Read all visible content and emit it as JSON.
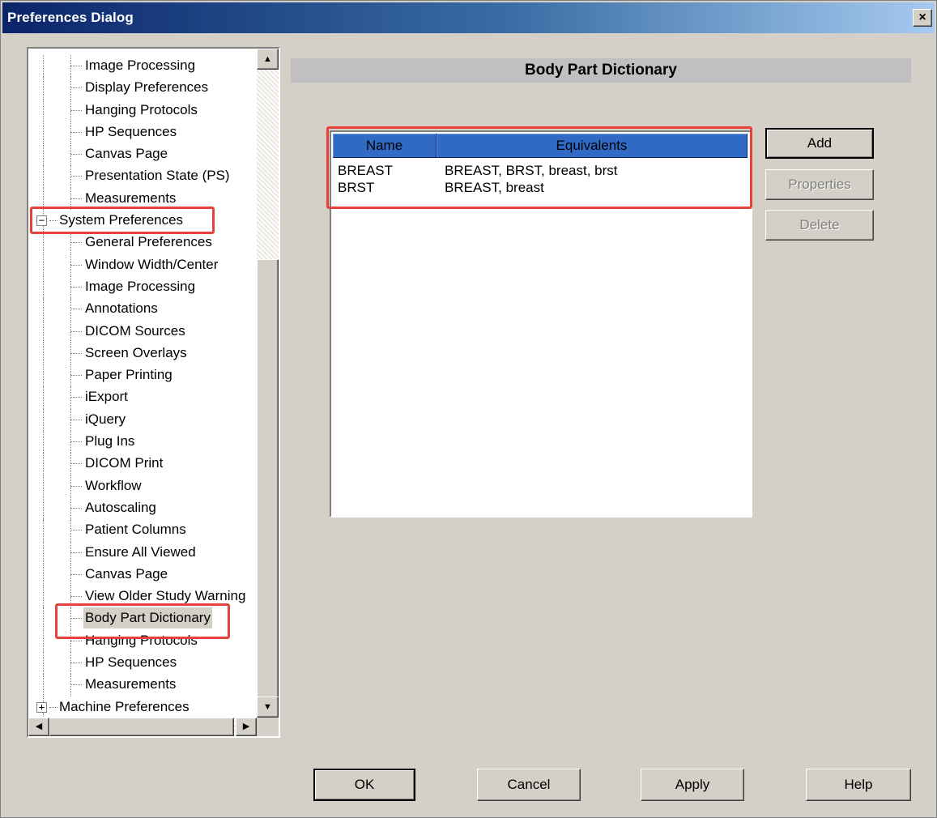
{
  "window": {
    "title": "Preferences Dialog",
    "close_label": "×"
  },
  "tree": {
    "items": [
      {
        "label": "Image Processing",
        "level": 1
      },
      {
        "label": "Display Preferences",
        "level": 1
      },
      {
        "label": "Hanging Protocols",
        "level": 1
      },
      {
        "label": "HP Sequences",
        "level": 1
      },
      {
        "label": "Canvas Page",
        "level": 1
      },
      {
        "label": "Presentation State (PS)",
        "level": 1
      },
      {
        "label": "Measurements",
        "level": 1
      },
      {
        "label": "System Preferences",
        "level": 0,
        "expander": "−"
      },
      {
        "label": "General Preferences",
        "level": 1
      },
      {
        "label": "Window Width/Center",
        "level": 1
      },
      {
        "label": "Image Processing",
        "level": 1
      },
      {
        "label": "Annotations",
        "level": 1
      },
      {
        "label": "DICOM Sources",
        "level": 1
      },
      {
        "label": "Screen Overlays",
        "level": 1
      },
      {
        "label": "Paper Printing",
        "level": 1
      },
      {
        "label": "iExport",
        "level": 1
      },
      {
        "label": "iQuery",
        "level": 1
      },
      {
        "label": "Plug Ins",
        "level": 1
      },
      {
        "label": "DICOM Print",
        "level": 1
      },
      {
        "label": "Workflow",
        "level": 1
      },
      {
        "label": "Autoscaling",
        "level": 1
      },
      {
        "label": "Patient Columns",
        "level": 1
      },
      {
        "label": "Ensure All Viewed",
        "level": 1
      },
      {
        "label": "Canvas Page",
        "level": 1
      },
      {
        "label": "View Older Study Warning",
        "level": 1
      },
      {
        "label": "Body Part Dictionary",
        "level": 1,
        "selected": true
      },
      {
        "label": "Hanging Protocols",
        "level": 1
      },
      {
        "label": "HP Sequences",
        "level": 1
      },
      {
        "label": "Measurements",
        "level": 1
      },
      {
        "label": "Machine Preferences",
        "level": 0,
        "expander": "+"
      }
    ],
    "scroll_up_glyph": "▲",
    "scroll_down_glyph": "▼",
    "scroll_left_glyph": "◀",
    "scroll_right_glyph": "▶"
  },
  "section": {
    "title": "Body Part Dictionary"
  },
  "listview": {
    "columns": [
      "Name",
      "Equivalents"
    ],
    "rows": [
      [
        "BREAST",
        "BREAST, BRST, breast, brst"
      ],
      [
        "BRST",
        "BREAST, breast"
      ]
    ]
  },
  "side_buttons": {
    "add": "Add",
    "properties": "Properties",
    "delete": "Delete"
  },
  "footer": {
    "ok": "OK",
    "cancel": "Cancel",
    "apply": "Apply",
    "help": "Help"
  },
  "colors": {
    "highlight": "#e8413c",
    "header_blue": "#316ac5",
    "dialog_bg": "#d4d0c8"
  }
}
